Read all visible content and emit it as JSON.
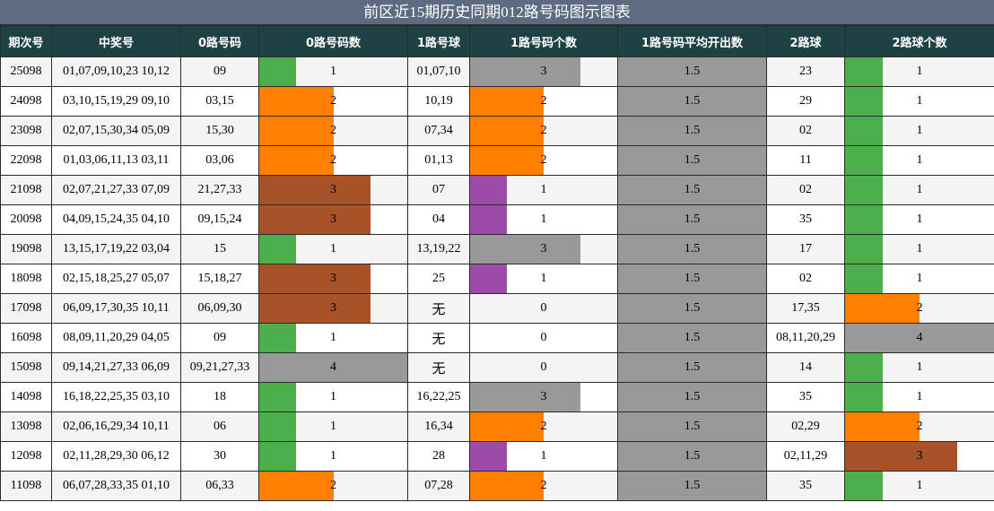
{
  "title": "前区近15期历史同期012路号码图示图表",
  "columns": [
    "期次号",
    "中奖号",
    "0路号码",
    "0路号码数",
    "1路号球",
    "1路号码个数",
    "1路号码平均开出数",
    "2路球",
    "2路球个数"
  ],
  "colors": {
    "1": "#4caf4c",
    "2": "#ff8000",
    "3": "#a8522a",
    "4": "#999999",
    "purple": "#9a4ca6",
    "gray": "#999999",
    "header_bg": "#1e4244",
    "title_bg": "#5d6b80"
  },
  "rows": [
    {
      "issue": "25098",
      "numbers": "01,07,09,10,23 10,12",
      "zero": "09",
      "zero_count": "1",
      "one": "01,07,10",
      "one_count": "3",
      "avg": "1.5",
      "two": "23",
      "two_count": "1"
    },
    {
      "issue": "24098",
      "numbers": "03,10,15,19,29 09,10",
      "zero": "03,15",
      "zero_count": "2",
      "one": "10,19",
      "one_count": "2",
      "avg": "1.5",
      "two": "29",
      "two_count": "1"
    },
    {
      "issue": "23098",
      "numbers": "02,07,15,30,34 05,09",
      "zero": "15,30",
      "zero_count": "2",
      "one": "07,34",
      "one_count": "2",
      "avg": "1.5",
      "two": "02",
      "two_count": "1"
    },
    {
      "issue": "22098",
      "numbers": "01,03,06,11,13 03,11",
      "zero": "03,06",
      "zero_count": "2",
      "one": "01,13",
      "one_count": "2",
      "avg": "1.5",
      "two": "11",
      "two_count": "1"
    },
    {
      "issue": "21098",
      "numbers": "02,07,21,27,33 07,09",
      "zero": "21,27,33",
      "zero_count": "3",
      "one": "07",
      "one_count": "1",
      "avg": "1.5",
      "two": "02",
      "two_count": "1"
    },
    {
      "issue": "20098",
      "numbers": "04,09,15,24,35 04,10",
      "zero": "09,15,24",
      "zero_count": "3",
      "one": "04",
      "one_count": "1",
      "avg": "1.5",
      "two": "35",
      "two_count": "1"
    },
    {
      "issue": "19098",
      "numbers": "13,15,17,19,22 03,04",
      "zero": "15",
      "zero_count": "1",
      "one": "13,19,22",
      "one_count": "3",
      "avg": "1.5",
      "two": "17",
      "two_count": "1"
    },
    {
      "issue": "18098",
      "numbers": "02,15,18,25,27 05,07",
      "zero": "15,18,27",
      "zero_count": "3",
      "one": "25",
      "one_count": "1",
      "avg": "1.5",
      "two": "02",
      "two_count": "1"
    },
    {
      "issue": "17098",
      "numbers": "06,09,17,30,35 10,11",
      "zero": "06,09,30",
      "zero_count": "3",
      "one": "无",
      "one_count": "0",
      "avg": "1.5",
      "two": "17,35",
      "two_count": "2"
    },
    {
      "issue": "16098",
      "numbers": "08,09,11,20,29 04,05",
      "zero": "09",
      "zero_count": "1",
      "one": "无",
      "one_count": "0",
      "avg": "1.5",
      "two": "08,11,20,29",
      "two_count": "4"
    },
    {
      "issue": "15098",
      "numbers": "09,14,21,27,33 06,09",
      "zero": "09,21,27,33",
      "zero_count": "4",
      "one": "无",
      "one_count": "0",
      "avg": "1.5",
      "two": "14",
      "two_count": "1"
    },
    {
      "issue": "14098",
      "numbers": "16,18,22,25,35 03,10",
      "zero": "18",
      "zero_count": "1",
      "one": "16,22,25",
      "one_count": "3",
      "avg": "1.5",
      "two": "35",
      "two_count": "1"
    },
    {
      "issue": "13098",
      "numbers": "02,06,16,29,34 10,11",
      "zero": "06",
      "zero_count": "1",
      "one": "16,34",
      "one_count": "2",
      "avg": "1.5",
      "two": "02,29",
      "two_count": "2"
    },
    {
      "issue": "12098",
      "numbers": "02,11,28,29,30 06,12",
      "zero": "30",
      "zero_count": "1",
      "one": "28",
      "one_count": "1",
      "avg": "1.5",
      "two": "02,11,29",
      "two_count": "3"
    },
    {
      "issue": "11098",
      "numbers": "06,07,28,33,35 01,10",
      "zero": "06,33",
      "zero_count": "2",
      "one": "07,28",
      "one_count": "2",
      "avg": "1.5",
      "two": "35",
      "two_count": "1"
    }
  ],
  "chart_data": {
    "type": "table",
    "title": "前区近15期历史同期012路号码图示图表",
    "bar_columns": [
      "0路号码数",
      "1路号码个数",
      "2路球个数"
    ],
    "bar_max": 4,
    "categories": [
      "25098",
      "24098",
      "23098",
      "22098",
      "21098",
      "20098",
      "19098",
      "18098",
      "17098",
      "16098",
      "15098",
      "14098",
      "13098",
      "12098",
      "11098"
    ],
    "series": [
      {
        "name": "0路号码数",
        "values": [
          1,
          2,
          2,
          2,
          3,
          3,
          1,
          3,
          3,
          1,
          4,
          1,
          1,
          1,
          2
        ]
      },
      {
        "name": "1路号码个数",
        "values": [
          3,
          2,
          2,
          2,
          1,
          1,
          3,
          1,
          0,
          0,
          0,
          3,
          2,
          1,
          2
        ]
      },
      {
        "name": "1路号码平均开出数",
        "values": [
          1.5,
          1.5,
          1.5,
          1.5,
          1.5,
          1.5,
          1.5,
          1.5,
          1.5,
          1.5,
          1.5,
          1.5,
          1.5,
          1.5,
          1.5
        ]
      },
      {
        "name": "2路球个数",
        "values": [
          1,
          1,
          1,
          1,
          1,
          1,
          1,
          1,
          2,
          4,
          1,
          1,
          2,
          3,
          1
        ]
      }
    ]
  }
}
